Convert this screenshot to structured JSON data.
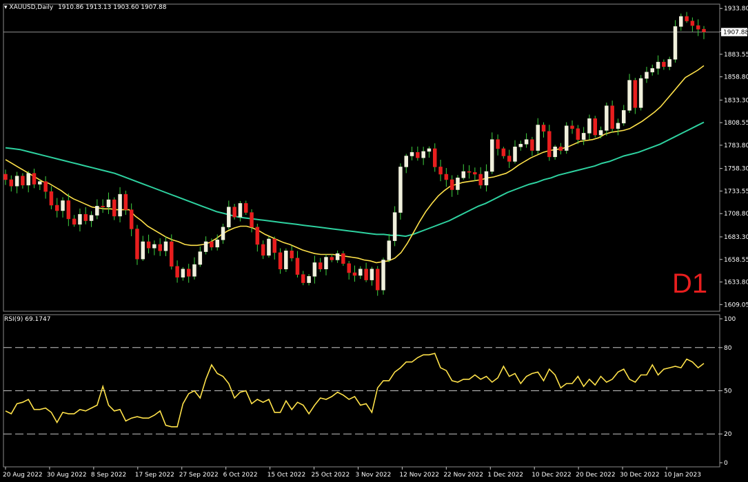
{
  "header": {
    "symbol": "XAUUSD,Daily",
    "ohlc": "1910.86 1913.13 1903.60 1907.88",
    "rsi_label": "RSI(9) 69.1747"
  },
  "overlay_label": "D1",
  "colors": {
    "bull": "#f0f0dc",
    "bear": "#e81e1e",
    "wick": "#3fd23f",
    "ma_fast": "#ffe24a",
    "ma_slow": "#2ed2a0",
    "rsi": "#ffe24a"
  },
  "chart_data": [
    {
      "type": "candlestick",
      "title": "XAUUSD,Daily",
      "x_tick_labels": [
        "20 Aug 2022",
        "30 Aug 2022",
        "8 Sep 2022",
        "17 Sep 2022",
        "27 Sep 2022",
        "6 Oct 2022",
        "15 Oct 2022",
        "25 Oct 2022",
        "3 Nov 2022",
        "12 Nov 2022",
        "22 Nov 2022",
        "1 Dec 2022",
        "10 Dec 2022",
        "20 Dec 2022",
        "30 Dec 2022",
        "10 Jan 2023"
      ],
      "y_tick_labels": [
        "1933.80",
        "1908.55",
        "1883.55",
        "1858.80",
        "1833.30",
        "1808.55",
        "1783.80",
        "1758.30",
        "1733.55",
        "1708.80",
        "1683.30",
        "1658.55",
        "1633.80",
        "1609.05"
      ],
      "ylim": [
        1604,
        1937
      ],
      "current_price": "1907.88",
      "closes": [
        1746,
        1739,
        1750,
        1740,
        1753,
        1741,
        1744,
        1733,
        1718,
        1712,
        1723,
        1703,
        1697,
        1708,
        1701,
        1707,
        1717,
        1716,
        1724,
        1706,
        1730,
        1713,
        1692,
        1659,
        1678,
        1671,
        1675,
        1668,
        1678,
        1651,
        1639,
        1648,
        1640,
        1653,
        1667,
        1678,
        1672,
        1680,
        1694,
        1716,
        1705,
        1720,
        1710,
        1694,
        1675,
        1663,
        1681,
        1666,
        1648,
        1668,
        1660,
        1642,
        1633,
        1640,
        1655,
        1648,
        1661,
        1658,
        1665,
        1654,
        1644,
        1641,
        1648,
        1636,
        1648,
        1625,
        1658,
        1679,
        1710,
        1760,
        1772,
        1776,
        1770,
        1777,
        1780,
        1760,
        1752,
        1746,
        1735,
        1748,
        1755,
        1754,
        1752,
        1740,
        1755,
        1790,
        1780,
        1772,
        1766,
        1782,
        1785,
        1790,
        1778,
        1806,
        1799,
        1771,
        1782,
        1778,
        1805,
        1802,
        1790,
        1797,
        1813,
        1795,
        1800,
        1827,
        1802,
        1808,
        1822,
        1855,
        1825,
        1857,
        1864,
        1868,
        1875,
        1870,
        1878,
        1914,
        1925,
        1920,
        1915,
        1911,
        1908
      ],
      "sma_20_approx": [
        1768,
        1764,
        1760,
        1756,
        1752,
        1748,
        1744,
        1742,
        1738,
        1734,
        1729,
        1725,
        1722,
        1719,
        1716,
        1715,
        1714,
        1714,
        1713,
        1713,
        1713,
        1706,
        1701,
        1695,
        1691,
        1687,
        1683,
        1680,
        1678,
        1675,
        1674,
        1674,
        1675,
        1677,
        1681,
        1686,
        1690,
        1693,
        1695,
        1695,
        1693,
        1690,
        1686,
        1683,
        1680,
        1677,
        1675,
        1672,
        1669,
        1667,
        1665,
        1664,
        1664,
        1664,
        1663,
        1662,
        1661,
        1660,
        1658,
        1657,
        1655,
        1656,
        1657,
        1660,
        1666,
        1676,
        1688,
        1700,
        1711,
        1720,
        1728,
        1734,
        1739,
        1741,
        1743,
        1744,
        1745,
        1746,
        1748,
        1749,
        1751,
        1753,
        1757,
        1762,
        1766,
        1770,
        1773,
        1776,
        1778,
        1779,
        1780,
        1782,
        1785,
        1788,
        1789,
        1790,
        1792,
        1796,
        1798,
        1799,
        1800,
        1802,
        1806,
        1810,
        1815,
        1820,
        1826,
        1834,
        1842,
        1850,
        1858,
        1862,
        1866,
        1871
      ],
      "sma_50_approx": [
        1781,
        1780,
        1779,
        1777,
        1775,
        1773,
        1771,
        1769,
        1767,
        1765,
        1763,
        1761,
        1759,
        1757,
        1755,
        1753,
        1750,
        1747,
        1744,
        1741,
        1738,
        1735,
        1732,
        1729,
        1726,
        1723,
        1720,
        1717,
        1714,
        1711,
        1709,
        1707,
        1705,
        1704,
        1703,
        1702,
        1701,
        1700,
        1699,
        1698,
        1697,
        1696,
        1695,
        1694,
        1693,
        1692,
        1691,
        1690,
        1689,
        1688,
        1687,
        1686,
        1686,
        1685,
        1685,
        1684,
        1686,
        1689,
        1692,
        1695,
        1698,
        1701,
        1705,
        1709,
        1713,
        1717,
        1720,
        1724,
        1728,
        1732,
        1735,
        1738,
        1741,
        1743,
        1746,
        1748,
        1751,
        1753,
        1755,
        1757,
        1759,
        1761,
        1764,
        1766,
        1769,
        1772,
        1774,
        1776,
        1779,
        1782,
        1785,
        1789,
        1793,
        1797,
        1801,
        1805,
        1809
      ],
      "sma_20_approx_first_x_index": 0,
      "sma_50_approx_first_x_index": 0
    },
    {
      "type": "line",
      "title": "RSI(9) 69.1747",
      "y_tick_labels": [
        "100",
        "80",
        "50",
        "20",
        "0"
      ],
      "levels": [
        80,
        50,
        20
      ],
      "ylim": [
        0,
        100
      ],
      "values": [
        36,
        34,
        41,
        42,
        44,
        37,
        37,
        38,
        35,
        28,
        35,
        34,
        34,
        37,
        36,
        38,
        40,
        53,
        40,
        36,
        37,
        29,
        31,
        32,
        31,
        31,
        33,
        36,
        26,
        25,
        25,
        41,
        48,
        50,
        45,
        58,
        68,
        62,
        60,
        55,
        45,
        49,
        50,
        41,
        44,
        42,
        44,
        35,
        35,
        43,
        37,
        42,
        40,
        34,
        40,
        45,
        44,
        46,
        49,
        47,
        44,
        46,
        40,
        41,
        35,
        52,
        57,
        57,
        63,
        66,
        70,
        70,
        73,
        75,
        75,
        76,
        66,
        64,
        57,
        56,
        58,
        58,
        61,
        58,
        60,
        56,
        59,
        67,
        60,
        62,
        55,
        60,
        62,
        63,
        57,
        65,
        61,
        52,
        55,
        55,
        60,
        53,
        58,
        54,
        60,
        56,
        58,
        63,
        65,
        58,
        56,
        61,
        61,
        68,
        61,
        65,
        66,
        67,
        66,
        72,
        70,
        66,
        69
      ]
    }
  ]
}
